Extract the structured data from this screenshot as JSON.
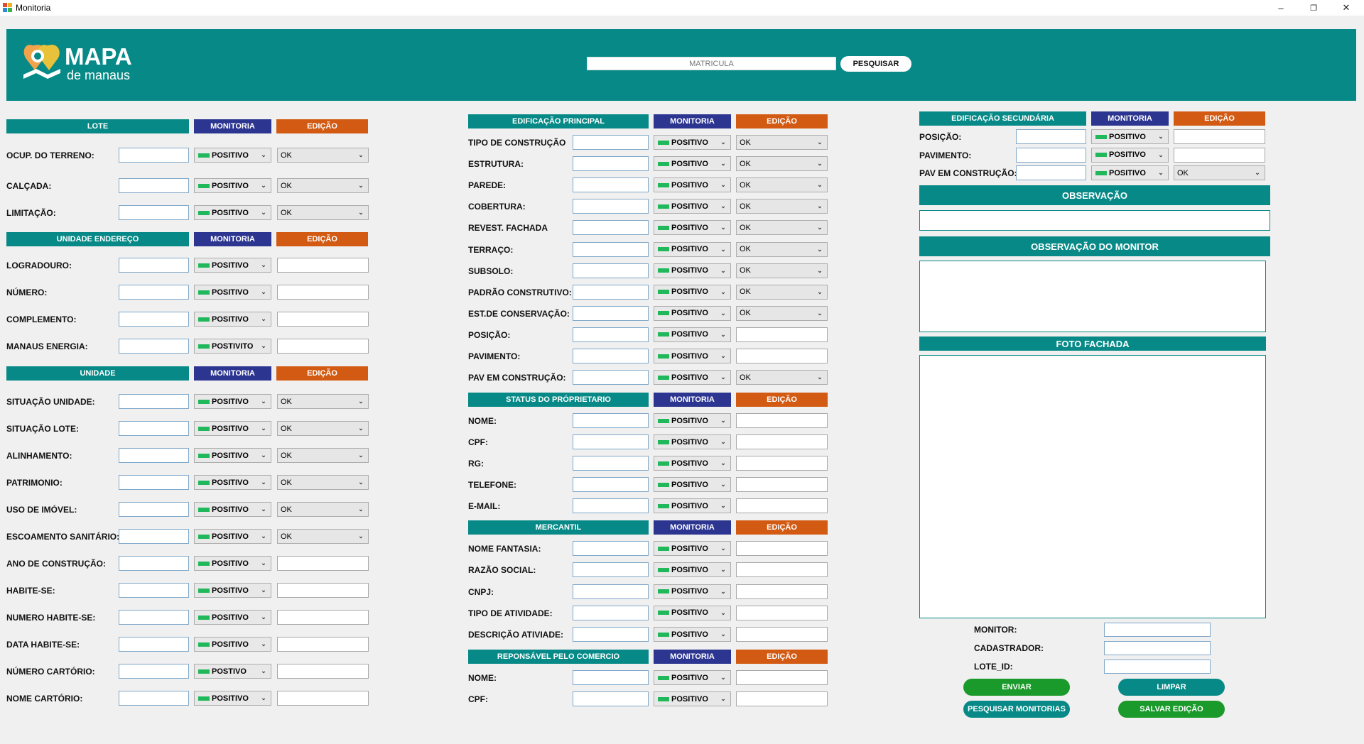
{
  "window": {
    "title": "Monitoria",
    "minimize": "–",
    "restore": "❐",
    "close": "✕"
  },
  "header": {
    "logo_title": "MAPA",
    "logo_subtitle": "de manaus",
    "search_placeholder": "MATRICULA",
    "search_button": "PESQUISAR"
  },
  "common": {
    "monitoria": "MONITORIA",
    "edicao": "EDIÇÃO",
    "ok": "OK"
  },
  "lote": {
    "title": "LOTE",
    "rows": [
      {
        "label": "OCUP. DO TERRENO:",
        "status": "POSITIVO",
        "edit": "OK"
      },
      {
        "label": "CALÇADA:",
        "status": "POSITIVO",
        "edit": "OK"
      },
      {
        "label": "LIMITAÇÃO:",
        "status": "POSITIVO",
        "edit": "OK"
      }
    ]
  },
  "unidade_endereco": {
    "title": "UNIDADE ENDEREÇO",
    "rows": [
      {
        "label": "LOGRADOURO:",
        "status": "POSITIVO"
      },
      {
        "label": "NÚMERO:",
        "status": "POSITIVO"
      },
      {
        "label": "COMPLEMENTO:",
        "status": "POSITIVO"
      },
      {
        "label": "MANAUS ENERGIA:",
        "status": "POSTIVITO"
      }
    ]
  },
  "unidade": {
    "title": "UNIDADE",
    "rows": [
      {
        "label": "SITUAÇÃO UNIDADE:",
        "status": "POSITIVO",
        "edit": "OK"
      },
      {
        "label": "SITUAÇÃO LOTE:",
        "status": "POSITIVO",
        "edit": "OK"
      },
      {
        "label": "ALINHAMENTO:",
        "status": "POSITIVO",
        "edit": "OK"
      },
      {
        "label": "PATRIMONIO:",
        "status": "POSITIVO",
        "edit": "OK"
      },
      {
        "label": "USO DE IMÓVEL:",
        "status": "POSITIVO",
        "edit": "OK"
      },
      {
        "label": "ESCOAMENTO SANITÁRIO:",
        "status": "POSITIVO",
        "edit": "OK"
      },
      {
        "label": "ANO DE CONSTRUÇÃO:",
        "status": "POSITIVO"
      },
      {
        "label": "HABITE-SE:",
        "status": "POSITIVO"
      },
      {
        "label": "NUMERO HABITE-SE:",
        "status": "POSITIVO"
      },
      {
        "label": "DATA HABITE-SE:",
        "status": "POSITIVO"
      },
      {
        "label": "NÚMERO CARTÓRIO:",
        "status": "POSTIVO"
      },
      {
        "label": "NOME CARTÓRIO:",
        "status": "POSITIVO"
      }
    ]
  },
  "edificacao_principal": {
    "title": "EDIFICAÇÃO PRINCIPAL",
    "rows": [
      {
        "label": "TIPO DE CONSTRUÇÃO",
        "status": "POSITIVO",
        "edit": "OK"
      },
      {
        "label": "ESTRUTURA:",
        "status": "POSITIVO",
        "edit": "OK"
      },
      {
        "label": "PAREDE:",
        "status": "POSITIVO",
        "edit": "OK"
      },
      {
        "label": "COBERTURA:",
        "status": "POSITIVO",
        "edit": "OK"
      },
      {
        "label": "REVEST. FACHADA",
        "status": "POSITIVO",
        "edit": "OK"
      },
      {
        "label": "TERRAÇO:",
        "status": "POSITIVO",
        "edit": "OK"
      },
      {
        "label": "SUBSOLO:",
        "status": "POSITIVO",
        "edit": "OK"
      },
      {
        "label": "PADRÃO CONSTRUTIVO:",
        "status": "POSITIVO",
        "edit": "OK"
      },
      {
        "label": "EST.DE CONSERVAÇÃO:",
        "status": "POSITIVO",
        "edit": "OK"
      },
      {
        "label": "POSIÇÃO:",
        "status": "POSITIVO"
      },
      {
        "label": "PAVIMENTO:",
        "status": "POSITIVO"
      },
      {
        "label": "PAV EM CONSTRUÇÃO:",
        "status": "POSITIVO",
        "edit": "OK"
      }
    ]
  },
  "status_proprietario": {
    "title": "STATUS DO PRÓPRIETARIO",
    "rows": [
      {
        "label": "NOME:",
        "status": "POSITIVO"
      },
      {
        "label": "CPF:",
        "status": "POSITIVO"
      },
      {
        "label": "RG:",
        "status": "POSITIVO"
      },
      {
        "label": "TELEFONE:",
        "status": "POSITIVO"
      },
      {
        "label": "E-MAIL:",
        "status": "POSITIVO"
      }
    ]
  },
  "mercantil": {
    "title": "MERCANTIL",
    "rows": [
      {
        "label": "NOME FANTASIA:",
        "status": "POSITIVO"
      },
      {
        "label": "RAZÃO SOCIAL:",
        "status": "POSITIVO"
      },
      {
        "label": "CNPJ:",
        "status": "POSITIVO"
      },
      {
        "label": "TIPO DE ATIVIDADE:",
        "status": "POSITIVO"
      },
      {
        "label": "DESCRIÇÃO ATIVIADE:",
        "status": "POSITIVO"
      }
    ]
  },
  "responsavel": {
    "title": "REPONSÁVEL PELO COMERCIO",
    "rows": [
      {
        "label": "NOME:",
        "status": "POSITIVO"
      },
      {
        "label": "CPF:",
        "status": "POSITIVO"
      }
    ]
  },
  "edificacao_secundaria": {
    "title": "EDIFICAÇÃO SECUNDÁRIA",
    "rows": [
      {
        "label": "POSIÇÃO:",
        "status": "POSITIVO"
      },
      {
        "label": "PAVIMENTO:",
        "status": "POSITIVO"
      },
      {
        "label": "PAV EM CONSTRUÇÃO:",
        "status": "POSITIVO",
        "edit": "OK"
      }
    ]
  },
  "right": {
    "observacao": "OBSERVAÇÃO",
    "observacao_monitor": "OBSERVAÇÃO DO MONITOR",
    "foto_fachada": "FOTO FACHADA",
    "monitor_label": "MONITOR:",
    "cadastrador_label": "CADASTRADOR:",
    "lote_id_label": "LOTE_ID:",
    "enviar": "ENVIAR",
    "limpar": "LIMPAR",
    "pesquisar_monitorias": "PESQUISAR MONITORIAS",
    "salvar_edicao": "SALVAR EDIÇÃO"
  },
  "colors": {
    "teal": "#078a87",
    "navy": "#2c3590",
    "orange": "#d25a12",
    "green": "#1a9a2a",
    "status_green": "#20b85a"
  }
}
